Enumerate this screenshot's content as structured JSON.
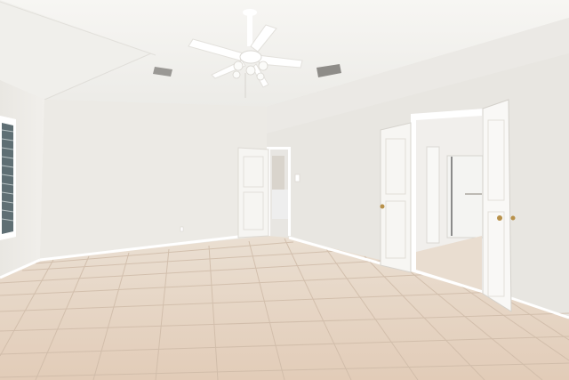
{
  "scene": {
    "description_free": true,
    "colors": {
      "ceiling": "#f4f3f0",
      "wall_left": "#eeece8",
      "wall_back": "#e9e7e2",
      "wall_right": "#ebe9e4",
      "floor": "#e3cfbd",
      "grout": "#cdb9a7",
      "door": "#f7f6f3",
      "trim": "#ffffff",
      "knob": "#b8914a"
    },
    "icons": [
      "ceiling-fan-icon",
      "air-vent-icon",
      "window-blinds-icon",
      "door-knob-icon"
    ]
  }
}
